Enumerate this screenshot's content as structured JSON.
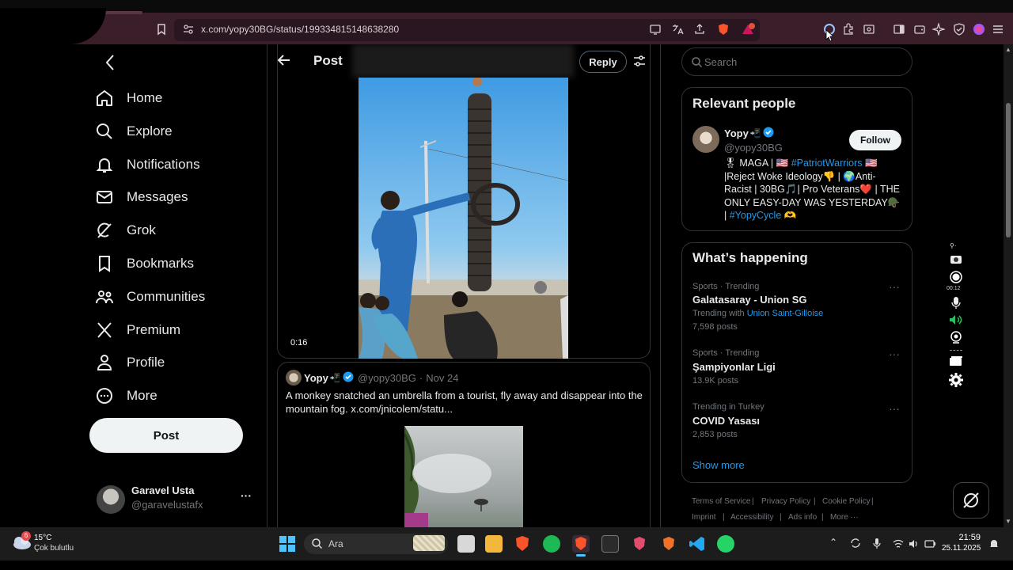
{
  "browser": {
    "url": "x.com/yopy30BG/status/1993348151486382​80",
    "colors": {
      "chrome": "#3a1f2a",
      "urlbar": "#2a1620"
    }
  },
  "nav": {
    "items": [
      {
        "label": "Home",
        "icon": "home-icon"
      },
      {
        "label": "Explore",
        "icon": "search-icon"
      },
      {
        "label": "Notifications",
        "icon": "bell-icon"
      },
      {
        "label": "Messages",
        "icon": "mail-icon"
      },
      {
        "label": "Grok",
        "icon": "grok-icon"
      },
      {
        "label": "Bookmarks",
        "icon": "bookmark-icon"
      },
      {
        "label": "Communities",
        "icon": "people-icon"
      },
      {
        "label": "Premium",
        "icon": "x-logo-icon"
      },
      {
        "label": "Profile",
        "icon": "user-icon"
      },
      {
        "label": "More",
        "icon": "more-circle-icon"
      }
    ],
    "post_label": "Post",
    "profile": {
      "name": "Garavel Usta",
      "handle": "@garavelustafx",
      "more": "···"
    }
  },
  "post_header": {
    "title": "Post",
    "reply_label": "Reply"
  },
  "video": {
    "duration": "0:16"
  },
  "quoted": {
    "name": "Yopy",
    "handle": "@yopy30BG",
    "dot": "·",
    "date": "Nov 24",
    "text": "A monkey snatched an umbrella from a tourist, fly away and disappear into the mountain fog.  x.com/jnicolem/statu..."
  },
  "search": {
    "placeholder": "Search"
  },
  "relevant": {
    "heading": "Relevant people",
    "name": "Yopy",
    "handle": "@yopy30BG",
    "follow_label": "Follow",
    "bio_1": "🎖 MAGA | 🇺🇸 ",
    "bio_tag": "#PatriotWarriors",
    "bio_2": " 🇺🇸 |Reject Woke Ideology👎 | 🌍Anti-Racist | 30BG🎵| Pro Veterans❤️ | THE ONLY EASY-DAY WAS YESTERDAY🪖 | ",
    "bio_tag2": "#YopyCycle",
    "bio_3": " 🫶"
  },
  "happening": {
    "heading": "What’s happening",
    "trends": [
      {
        "meta": "Sports · Trending",
        "title": "Galatasaray - Union SG",
        "with_label": "Trending with ",
        "with_link": "Union Saint-Gilloise",
        "posts": "7,598 posts"
      },
      {
        "meta": "Sports · Trending",
        "title": "Şampiyonlar Ligi",
        "posts": "13.9K posts"
      },
      {
        "meta": "Trending in Turkey",
        "title": "COVID Yasası",
        "posts": "2,853 posts"
      }
    ],
    "show_more": "Show more"
  },
  "footer_links": [
    "Terms of Service",
    "|",
    "Privacy Policy",
    "|",
    "Cookie Policy",
    "|",
    "Imprint",
    "|",
    "Accessibility",
    "|",
    "Ads info",
    "|",
    "More ···"
  ],
  "recorder": {
    "time": "00:12"
  },
  "taskbar": {
    "weather_temp": "15°C",
    "weather_desc": "Çok bulutlu",
    "weather_badge": "6",
    "search_placeholder": "Ara",
    "time": "21:59",
    "date": "25.11.2025"
  }
}
